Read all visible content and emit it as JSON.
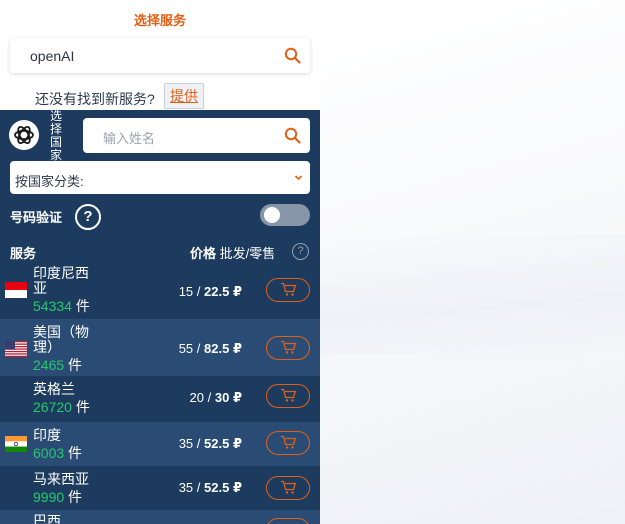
{
  "service_panel": {
    "title": "选择服务",
    "search_value": "openAI",
    "not_found_text": "还没有找到新服务?",
    "provide_label": "提供"
  },
  "country_panel": {
    "vertical_label": "选择国家",
    "name_search_placeholder": "输入姓名",
    "category_select_label": "按国家分类:",
    "number_verify_label": "号码验证",
    "help_glyph": "?",
    "toggle_on": false
  },
  "table_header": {
    "service": "服务",
    "price_bold": "价格",
    "price_rest": "批发/零售",
    "help_glyph": "?"
  },
  "rows": [
    {
      "country": "印度尼西亚",
      "count": "54334",
      "unit": "件",
      "wholesale": "15",
      "retail": "22.5",
      "currency": "₽",
      "flag": "indonesia"
    },
    {
      "country": "美国（物理）",
      "count": "2465",
      "unit": "件",
      "wholesale": "55",
      "retail": "82.5",
      "currency": "₽",
      "flag": "usa"
    },
    {
      "country": "英格兰",
      "count": "26720",
      "unit": "件",
      "wholesale": "20",
      "retail": "30",
      "currency": "₽",
      "flag": "none"
    },
    {
      "country": "印度",
      "count": "6003",
      "unit": "件",
      "wholesale": "35",
      "retail": "52.5",
      "currency": "₽",
      "flag": "india"
    },
    {
      "country": "马来西亚",
      "count": "9990",
      "unit": "件",
      "wholesale": "35",
      "retail": "52.5",
      "currency": "₽",
      "flag": "none"
    },
    {
      "country": "巴西",
      "count": "",
      "unit": "",
      "wholesale": "",
      "retail": "",
      "currency": "",
      "flag": "none"
    }
  ],
  "icons": {
    "search": "search-icon",
    "chevron": "chevron-down-icon",
    "cart": "cart-icon",
    "logo": "openai-logo-icon"
  },
  "colors": {
    "accent": "#e35f14",
    "panel_dark": "#1d3b5e",
    "row_alt": "#2a4c74",
    "count_green": "#28c76f"
  }
}
